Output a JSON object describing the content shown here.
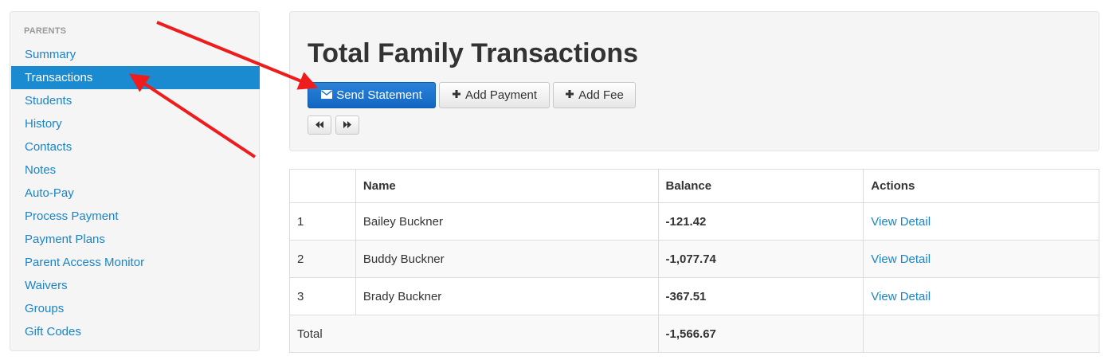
{
  "sidebar": {
    "header": "PARENTS",
    "items": [
      {
        "label": "Summary"
      },
      {
        "label": "Transactions",
        "active": true
      },
      {
        "label": "Students"
      },
      {
        "label": "History"
      },
      {
        "label": "Contacts"
      },
      {
        "label": "Notes"
      },
      {
        "label": "Auto-Pay"
      },
      {
        "label": "Process Payment"
      },
      {
        "label": "Payment Plans"
      },
      {
        "label": "Parent Access Monitor"
      },
      {
        "label": "Waivers"
      },
      {
        "label": "Groups"
      },
      {
        "label": "Gift Codes"
      }
    ]
  },
  "header": {
    "title": "Total Family Transactions",
    "send_statement_label": "Send Statement",
    "add_payment_label": "Add Payment",
    "add_fee_label": "Add Fee"
  },
  "table": {
    "columns": [
      "",
      "Name",
      "Balance",
      "Actions"
    ],
    "rows": [
      {
        "index": "1",
        "name": "Bailey Buckner",
        "balance": "-121.42",
        "action": "View Detail"
      },
      {
        "index": "2",
        "name": "Buddy Buckner",
        "balance": "-1,077.74",
        "action": "View Detail"
      },
      {
        "index": "3",
        "name": "Brady Buckner",
        "balance": "-367.51",
        "action": "View Detail"
      }
    ],
    "total_label": "Total",
    "total_balance": "-1,566.67"
  },
  "colors": {
    "link": "#1a84c7",
    "active_nav": "#1a8bd1",
    "primary_button": "#1266c3",
    "negative": "#e3262b",
    "annotation_arrow": "#ee1c1c"
  },
  "icons": {
    "send_statement": "envelope-icon",
    "add_payment": "plus-icon",
    "add_fee": "plus-icon",
    "prev": "backward-icon",
    "next": "forward-icon"
  }
}
